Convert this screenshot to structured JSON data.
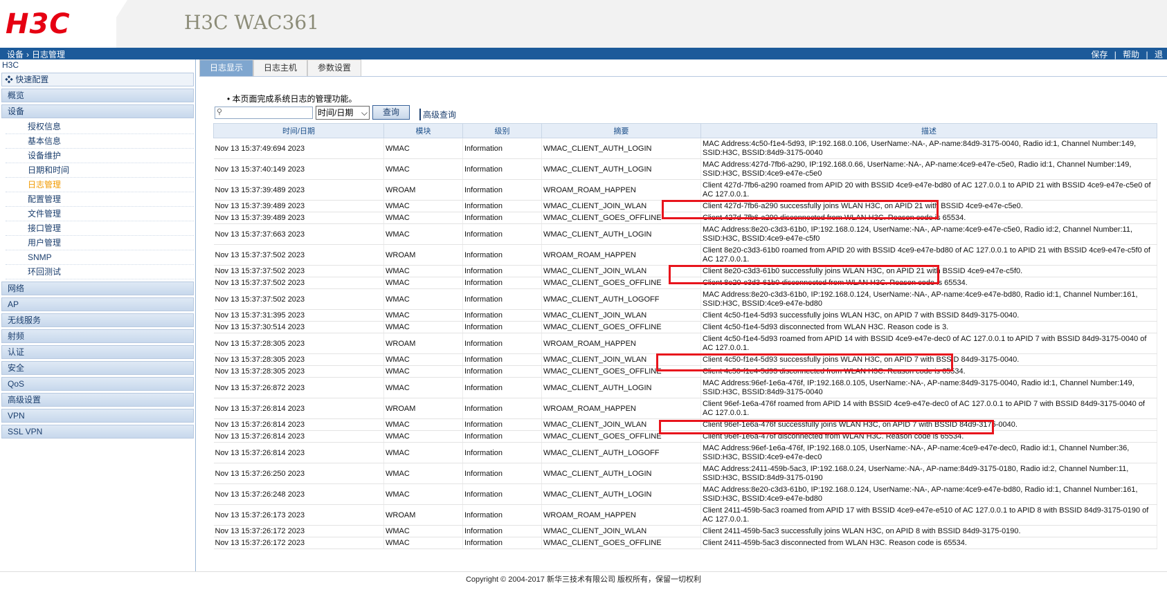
{
  "header": {
    "logo": "H3C",
    "product": "H3C WAC361"
  },
  "topbar": {
    "crumb_home": "设备",
    "crumb_sep": "›",
    "crumb_page": "日志管理",
    "save": "保存",
    "sep": "|",
    "help": "帮助",
    "sep2": "|",
    "more": "退"
  },
  "sidebar": {
    "root": "H3C",
    "quick": "快速配置",
    "cats_top": [
      "概览",
      "设备"
    ],
    "subs": [
      "授权信息",
      "基本信息",
      "设备维护",
      "日期和时间",
      "日志管理",
      "配置管理",
      "文件管理",
      "接口管理",
      "用户管理",
      "SNMP",
      "环回测试"
    ],
    "cats_bottom": [
      "网络",
      "AP",
      "无线服务",
      "射频",
      "认证",
      "安全",
      "QoS",
      "高级设置",
      "VPN",
      "SSL VPN"
    ]
  },
  "tabs": [
    "日志显示",
    "日志主机",
    "参数设置"
  ],
  "intro": "本页面完成系统日志的管理功能。",
  "search": {
    "placeholder": "",
    "select_value": "时间/日期",
    "button": "查询",
    "advanced": "高级查询"
  },
  "table": {
    "headers": [
      "时间/日期",
      "模块",
      "级别",
      "摘要",
      "描述"
    ],
    "rows": [
      [
        "Nov 13 15:37:49:694 2023",
        "WMAC",
        "Information",
        "WMAC_CLIENT_AUTH_LOGIN",
        "MAC Address:4c50-f1e4-5d93, IP:192.168.0.106, UserName:-NA-, AP-name:84d9-3175-0040, Radio id:1, Channel Number:149, SSID:H3C, BSSID:84d9-3175-0040"
      ],
      [
        "Nov 13 15:37:40:149 2023",
        "WMAC",
        "Information",
        "WMAC_CLIENT_AUTH_LOGIN",
        "MAC Address:427d-7fb6-a290, IP:192.168.0.66, UserName:-NA-, AP-name:4ce9-e47e-c5e0, Radio id:1, Channel Number:149, SSID:H3C, BSSID:4ce9-e47e-c5e0"
      ],
      [
        "Nov 13 15:37:39:489 2023",
        "WROAM",
        "Information",
        "WROAM_ROAM_HAPPEN",
        "Client 427d-7fb6-a290 roamed from APID 20 with BSSID 4ce9-e47e-bd80 of AC 127.0.0.1 to APID 21 with BSSID 4ce9-e47e-c5e0 of AC 127.0.0.1."
      ],
      [
        "Nov 13 15:37:39:489 2023",
        "WMAC",
        "Information",
        "WMAC_CLIENT_JOIN_WLAN",
        "Client 427d-7fb6-a290 successfully joins WLAN H3C, on APID 21 with BSSID 4ce9-e47e-c5e0."
      ],
      [
        "Nov 13 15:37:39:489 2023",
        "WMAC",
        "Information",
        "WMAC_CLIENT_GOES_OFFLINE",
        "Client 427d-7fb6-a290 disconnected from WLAN H3C. Reason code is 65534."
      ],
      [
        "Nov 13 15:37:37:663 2023",
        "WMAC",
        "Information",
        "WMAC_CLIENT_AUTH_LOGIN",
        "MAC Address:8e20-c3d3-61b0, IP:192.168.0.124, UserName:-NA-, AP-name:4ce9-e47e-c5e0, Radio id:2, Channel Number:11, SSID:H3C, BSSID:4ce9-e47e-c5f0"
      ],
      [
        "Nov 13 15:37:37:502 2023",
        "WROAM",
        "Information",
        "WROAM_ROAM_HAPPEN",
        "Client 8e20-c3d3-61b0 roamed from APID 20 with BSSID 4ce9-e47e-bd80 of AC 127.0.0.1 to APID 21 with BSSID 4ce9-e47e-c5f0 of AC 127.0.0.1."
      ],
      [
        "Nov 13 15:37:37:502 2023",
        "WMAC",
        "Information",
        "WMAC_CLIENT_JOIN_WLAN",
        "Client 8e20-c3d3-61b0 successfully joins WLAN H3C, on APID 21 with BSSID 4ce9-e47e-c5f0."
      ],
      [
        "Nov 13 15:37:37:502 2023",
        "WMAC",
        "Information",
        "WMAC_CLIENT_GOES_OFFLINE",
        "Client 8e20-c3d3-61b0 disconnected from WLAN H3C. Reason code is 65534."
      ],
      [
        "Nov 13 15:37:37:502 2023",
        "WMAC",
        "Information",
        "WMAC_CLIENT_AUTH_LOGOFF",
        "MAC Address:8e20-c3d3-61b0, IP:192.168.0.124, UserName:-NA-, AP-name:4ce9-e47e-bd80, Radio id:1, Channel Number:161, SSID:H3C, BSSID:4ce9-e47e-bd80"
      ],
      [
        "Nov 13 15:37:31:395 2023",
        "WMAC",
        "Information",
        "WMAC_CLIENT_JOIN_WLAN",
        "Client 4c50-f1e4-5d93 successfully joins WLAN H3C, on APID 7 with BSSID 84d9-3175-0040."
      ],
      [
        "Nov 13 15:37:30:514 2023",
        "WMAC",
        "Information",
        "WMAC_CLIENT_GOES_OFFLINE",
        "Client 4c50-f1e4-5d93 disconnected from WLAN H3C. Reason code is 3."
      ],
      [
        "Nov 13 15:37:28:305 2023",
        "WROAM",
        "Information",
        "WROAM_ROAM_HAPPEN",
        "Client 4c50-f1e4-5d93 roamed from APID 14 with BSSID 4ce9-e47e-dec0 of AC 127.0.0.1 to APID 7 with BSSID 84d9-3175-0040 of AC 127.0.0.1."
      ],
      [
        "Nov 13 15:37:28:305 2023",
        "WMAC",
        "Information",
        "WMAC_CLIENT_JOIN_WLAN",
        "Client 4c50-f1e4-5d93 successfully joins WLAN H3C, on APID 7 with BSSID 84d9-3175-0040."
      ],
      [
        "Nov 13 15:37:28:305 2023",
        "WMAC",
        "Information",
        "WMAC_CLIENT_GOES_OFFLINE",
        "Client 4c50-f1e4-5d93 disconnected from WLAN H3C. Reason code is 65534."
      ],
      [
        "Nov 13 15:37:26:872 2023",
        "WMAC",
        "Information",
        "WMAC_CLIENT_AUTH_LOGIN",
        "MAC Address:96ef-1e6a-476f, IP:192.168.0.105, UserName:-NA-, AP-name:84d9-3175-0040, Radio id:1, Channel Number:149, SSID:H3C, BSSID:84d9-3175-0040"
      ],
      [
        "Nov 13 15:37:26:814 2023",
        "WROAM",
        "Information",
        "WROAM_ROAM_HAPPEN",
        "Client 96ef-1e6a-476f roamed from APID 14 with BSSID 4ce9-e47e-dec0 of AC 127.0.0.1 to APID 7 with BSSID 84d9-3175-0040 of AC 127.0.0.1."
      ],
      [
        "Nov 13 15:37:26:814 2023",
        "WMAC",
        "Information",
        "WMAC_CLIENT_JOIN_WLAN",
        "Client 96ef-1e6a-476f successfully joins WLAN H3C, on APID 7 with BSSID 84d9-3175-0040."
      ],
      [
        "Nov 13 15:37:26:814 2023",
        "WMAC",
        "Information",
        "WMAC_CLIENT_GOES_OFFLINE",
        "Client 96ef-1e6a-476f disconnected from WLAN H3C. Reason code is 65534."
      ],
      [
        "Nov 13 15:37:26:814 2023",
        "WMAC",
        "Information",
        "WMAC_CLIENT_AUTH_LOGOFF",
        "MAC Address:96ef-1e6a-476f, IP:192.168.0.105, UserName:-NA-, AP-name:4ce9-e47e-dec0, Radio id:1, Channel Number:36, SSID:H3C, BSSID:4ce9-e47e-dec0"
      ],
      [
        "Nov 13 15:37:26:250 2023",
        "WMAC",
        "Information",
        "WMAC_CLIENT_AUTH_LOGIN",
        "MAC Address:2411-459b-5ac3, IP:192.168.0.24, UserName:-NA-, AP-name:84d9-3175-0180, Radio id:2, Channel Number:11, SSID:H3C, BSSID:84d9-3175-0190"
      ],
      [
        "Nov 13 15:37:26:248 2023",
        "WMAC",
        "Information",
        "WMAC_CLIENT_AUTH_LOGIN",
        "MAC Address:8e20-c3d3-61b0, IP:192.168.0.124, UserName:-NA-, AP-name:4ce9-e47e-bd80, Radio id:1, Channel Number:161, SSID:H3C, BSSID:4ce9-e47e-bd80"
      ],
      [
        "Nov 13 15:37:26:173 2023",
        "WROAM",
        "Information",
        "WROAM_ROAM_HAPPEN",
        "Client 2411-459b-5ac3 roamed from APID 17 with BSSID 4ce9-e47e-e510 of AC 127.0.0.1 to APID 8 with BSSID 84d9-3175-0190 of AC 127.0.0.1."
      ],
      [
        "Nov 13 15:37:26:172 2023",
        "WMAC",
        "Information",
        "WMAC_CLIENT_JOIN_WLAN",
        "Client 2411-459b-5ac3 successfully joins WLAN H3C, on APID 8 with BSSID 84d9-3175-0190."
      ],
      [
        "Nov 13 15:37:26:172 2023",
        "WMAC",
        "Information",
        "WMAC_CLIENT_GOES_OFFLINE",
        "Client 2411-459b-5ac3 disconnected from WLAN H3C. Reason code is 65534."
      ]
    ]
  },
  "footer": "Copyright © 2004-2017 新华三技术有限公司 版权所有，保留一切权利",
  "colors": {
    "highlight": "#e8141c",
    "topbar": "#1c5a9a",
    "brand": "#e60012"
  }
}
